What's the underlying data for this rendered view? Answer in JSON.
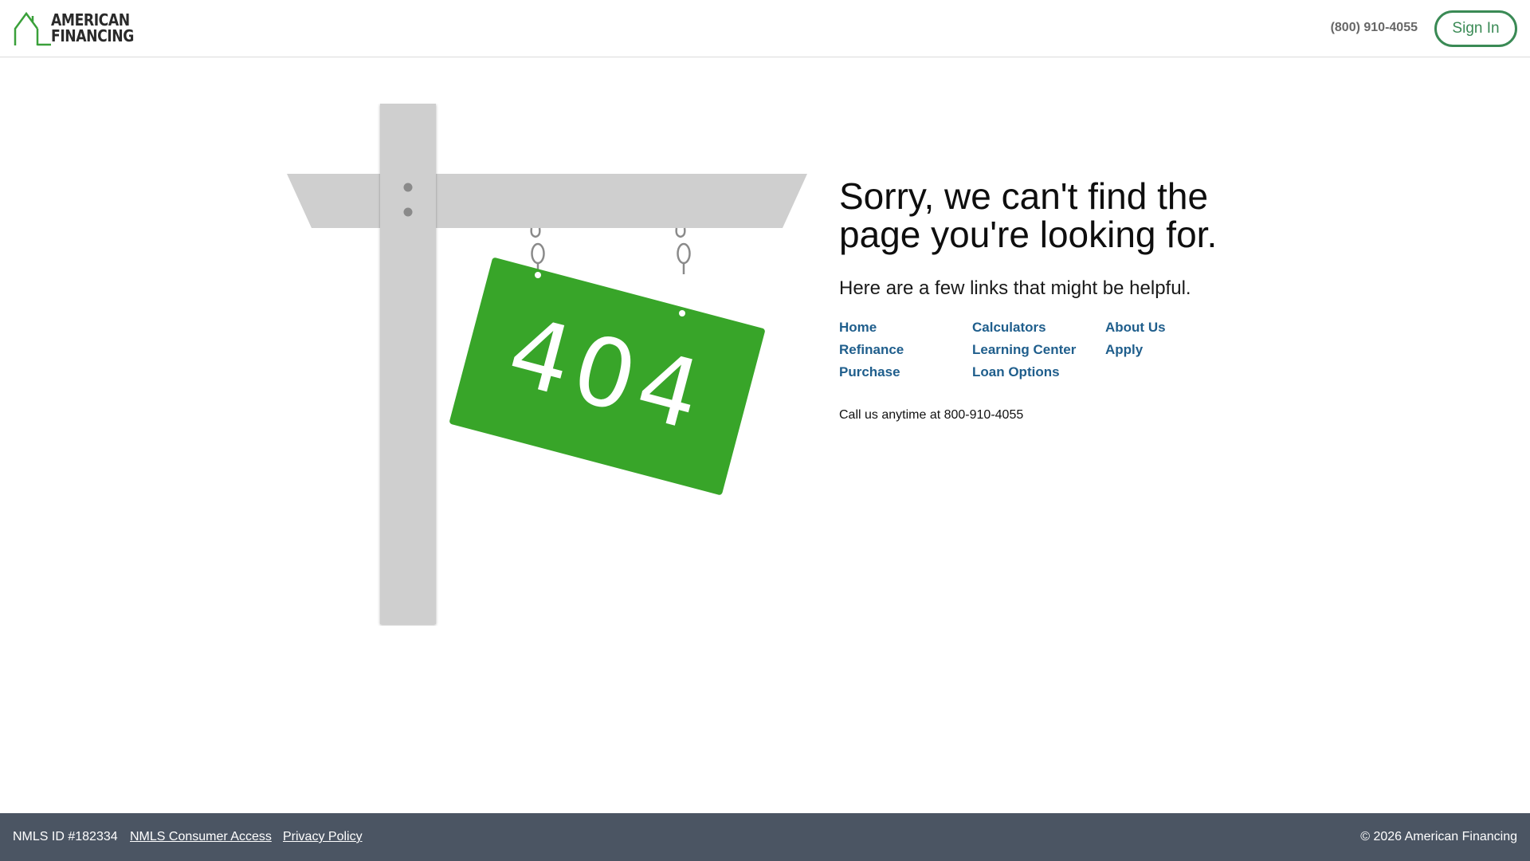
{
  "header": {
    "logo_line1": "AMERICAN",
    "logo_line2": "FINANCING",
    "phone": "(800) 910-4055",
    "signin_label": "Sign In"
  },
  "illustration": {
    "sign_text": "404",
    "sign_color": "#38a529",
    "post_color": "#cfcfcf"
  },
  "main": {
    "headline": "Sorry, we can't find the page you're looking for.",
    "subhead": "Here are a few links that might be helpful.",
    "links": [
      "Home",
      "Calculators",
      "About Us",
      "Refinance",
      "Learning Center",
      "Apply",
      "Purchase",
      "Loan Options"
    ],
    "call_us": "Call us anytime at 800-910-4055"
  },
  "footer": {
    "nmls_id": "NMLS ID #182334",
    "consumer_access": "NMLS Consumer Access",
    "privacy_policy": "Privacy Policy",
    "copyright": "© 2026 American Financing"
  },
  "colors": {
    "brand_green": "#3a8a55",
    "link_blue": "#1f5e8c",
    "footer_bg": "#4b5563"
  }
}
